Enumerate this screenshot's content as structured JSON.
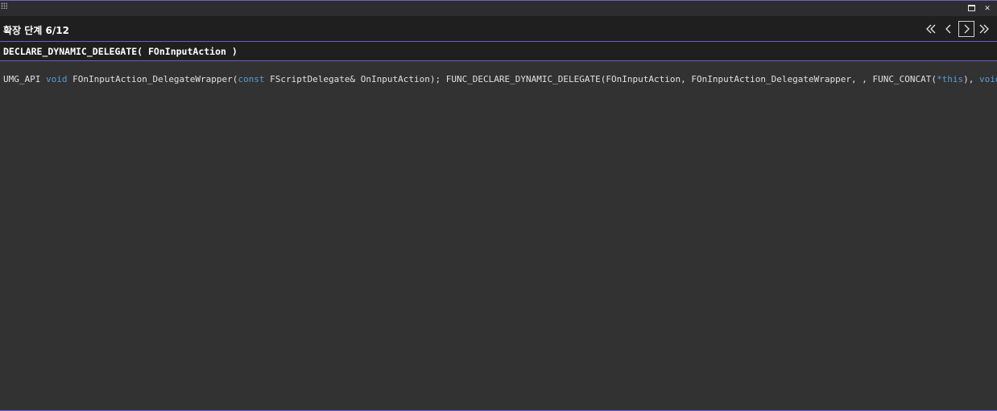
{
  "window": {
    "float_icon": "float-window-icon",
    "close_icon": "close-icon"
  },
  "header": {
    "step_text": "확장 단계 6/12",
    "nav": {
      "first_icon": "double-chevron-left-icon",
      "prev_icon": "chevron-left-icon",
      "next_icon": "chevron-right-icon",
      "last_icon": "double-chevron-right-icon"
    }
  },
  "macro": {
    "title": "DECLARE_DYNAMIC_DELEGATE( FOnInputAction )"
  },
  "code": {
    "t1": "UMG_API ",
    "k1": "void",
    "t2": " FOnInputAction_DelegateWrapper(",
    "k2": "const",
    "t3": " FScriptDelegate& OnInputAction); FUNC_DECLARE_DYNAMIC_DELEGATE(FOnInputAction, FOnInputAction_DelegateWrapper, , FUNC_CONCAT(",
    "k3": "*this",
    "t4": "), ",
    "k4": "void",
    "t5": ")"
  },
  "colors": {
    "background": "#323232",
    "header_bg": "#1f1f1f",
    "accent_border": "#6a5fc1",
    "keyword": "#569cd6",
    "text": "#e0e0e0"
  }
}
